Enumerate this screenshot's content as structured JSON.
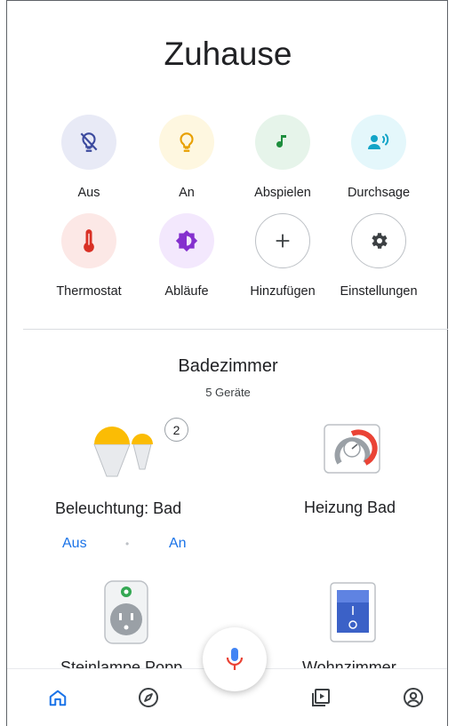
{
  "header": {
    "title": "Zuhause"
  },
  "shortcuts": [
    {
      "label": "Aus",
      "icon": "lightbulb-off-icon",
      "bg": "#e8eaf6",
      "fg": "#3c4a9e"
    },
    {
      "label": "An",
      "icon": "lightbulb-icon",
      "bg": "#fef7e0",
      "fg": "#e8a000"
    },
    {
      "label": "Abspielen",
      "icon": "music-note-icon",
      "bg": "#e6f4ea",
      "fg": "#1e8e3e"
    },
    {
      "label": "Durchsage",
      "icon": "broadcast-icon",
      "bg": "#e4f7fb",
      "fg": "#12a4c7"
    },
    {
      "label": "Thermostat",
      "icon": "thermometer-icon",
      "bg": "#fce8e6",
      "fg": "#d93025"
    },
    {
      "label": "Abläufe",
      "icon": "routines-icon",
      "bg": "#f3e8fd",
      "fg": "#8430ce"
    },
    {
      "label": "Hinzufügen",
      "icon": "plus-icon",
      "bg": "#ffffff",
      "fg": "#3c4043"
    },
    {
      "label": "Einstellungen",
      "icon": "gear-icon",
      "bg": "#ffffff",
      "fg": "#3c4043"
    }
  ],
  "room": {
    "name": "Badezimmer",
    "device_count": "5 Geräte",
    "devices": [
      {
        "name": "Beleuchtung: Bad",
        "badge": "2",
        "off_label": "Aus",
        "on_label": "An",
        "separator": "•"
      },
      {
        "name": "Heizung Bad"
      },
      {
        "name": "Steinlampe Popp"
      },
      {
        "name": "Wohnzimmer"
      }
    ]
  },
  "bottom_nav": [
    {
      "icon": "home-icon",
      "active": true
    },
    {
      "icon": "compass-icon",
      "active": false
    },
    {
      "icon": "media-icon",
      "active": false
    },
    {
      "icon": "account-icon",
      "active": false
    }
  ],
  "colors": {
    "accent": "#1a73e8",
    "mic_blue": "#4285f4",
    "mic_red": "#ea4335"
  }
}
